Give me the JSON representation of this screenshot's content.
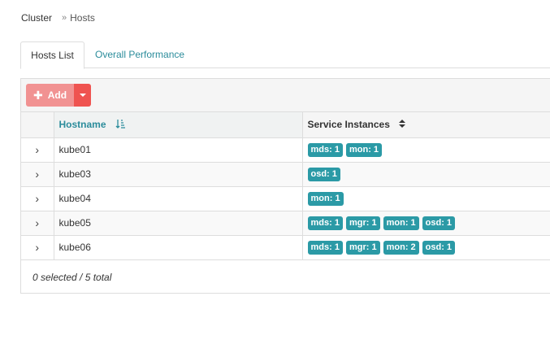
{
  "breadcrumb": {
    "root": "Cluster",
    "separator": "»",
    "current": "Hosts"
  },
  "tabs": [
    {
      "label": "Hosts List",
      "active": true
    },
    {
      "label": "Overall Performance",
      "active": false
    }
  ],
  "toolbar": {
    "add_label": "Add"
  },
  "table": {
    "columns": {
      "hostname": "Hostname",
      "services": "Service Instances"
    },
    "rows": [
      {
        "hostname": "kube01",
        "services": [
          "mds: 1",
          "mon: 1"
        ]
      },
      {
        "hostname": "kube03",
        "services": [
          "osd: 1"
        ]
      },
      {
        "hostname": "kube04",
        "services": [
          "mon: 1"
        ]
      },
      {
        "hostname": "kube05",
        "services": [
          "mds: 1",
          "mgr: 1",
          "mon: 1",
          "osd: 1"
        ]
      },
      {
        "hostname": "kube06",
        "services": [
          "mds: 1",
          "mgr: 1",
          "mon: 2",
          "osd: 1"
        ]
      }
    ]
  },
  "footer": {
    "summary": "0 selected / 5 total"
  },
  "colors": {
    "accent": "#2b8c9b",
    "badge": "#2b9aa6",
    "add_button": "#f19292",
    "add_caret": "#ef5350"
  }
}
